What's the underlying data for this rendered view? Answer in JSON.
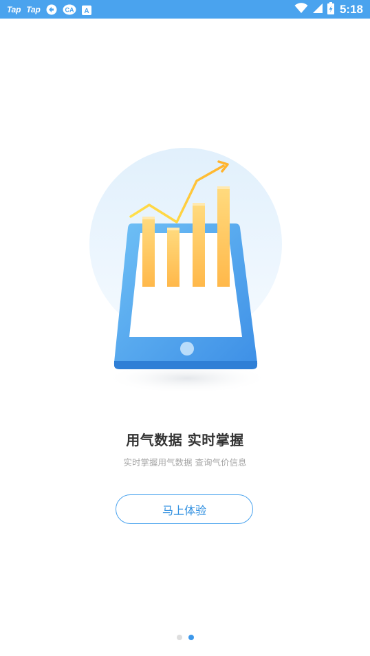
{
  "status_bar": {
    "app1_label": "Tap",
    "app2_label": "Tap",
    "icons": [
      "arrows-sync-icon",
      "ca-badge-icon",
      "a-square-icon",
      "wifi-icon",
      "signal-icon",
      "battery-icon"
    ],
    "time": "5:18",
    "background": "#4aa3ee"
  },
  "onboarding": {
    "headline": "用气数据  实时掌握",
    "subline": "实时掌握用气数据  查询气价信息",
    "cta_label": "马上体验",
    "accent": "#4aa3ee",
    "illustration": "tablet-growth-chart-illustration"
  },
  "pager": {
    "total_pages": 2,
    "current_page": 2
  }
}
